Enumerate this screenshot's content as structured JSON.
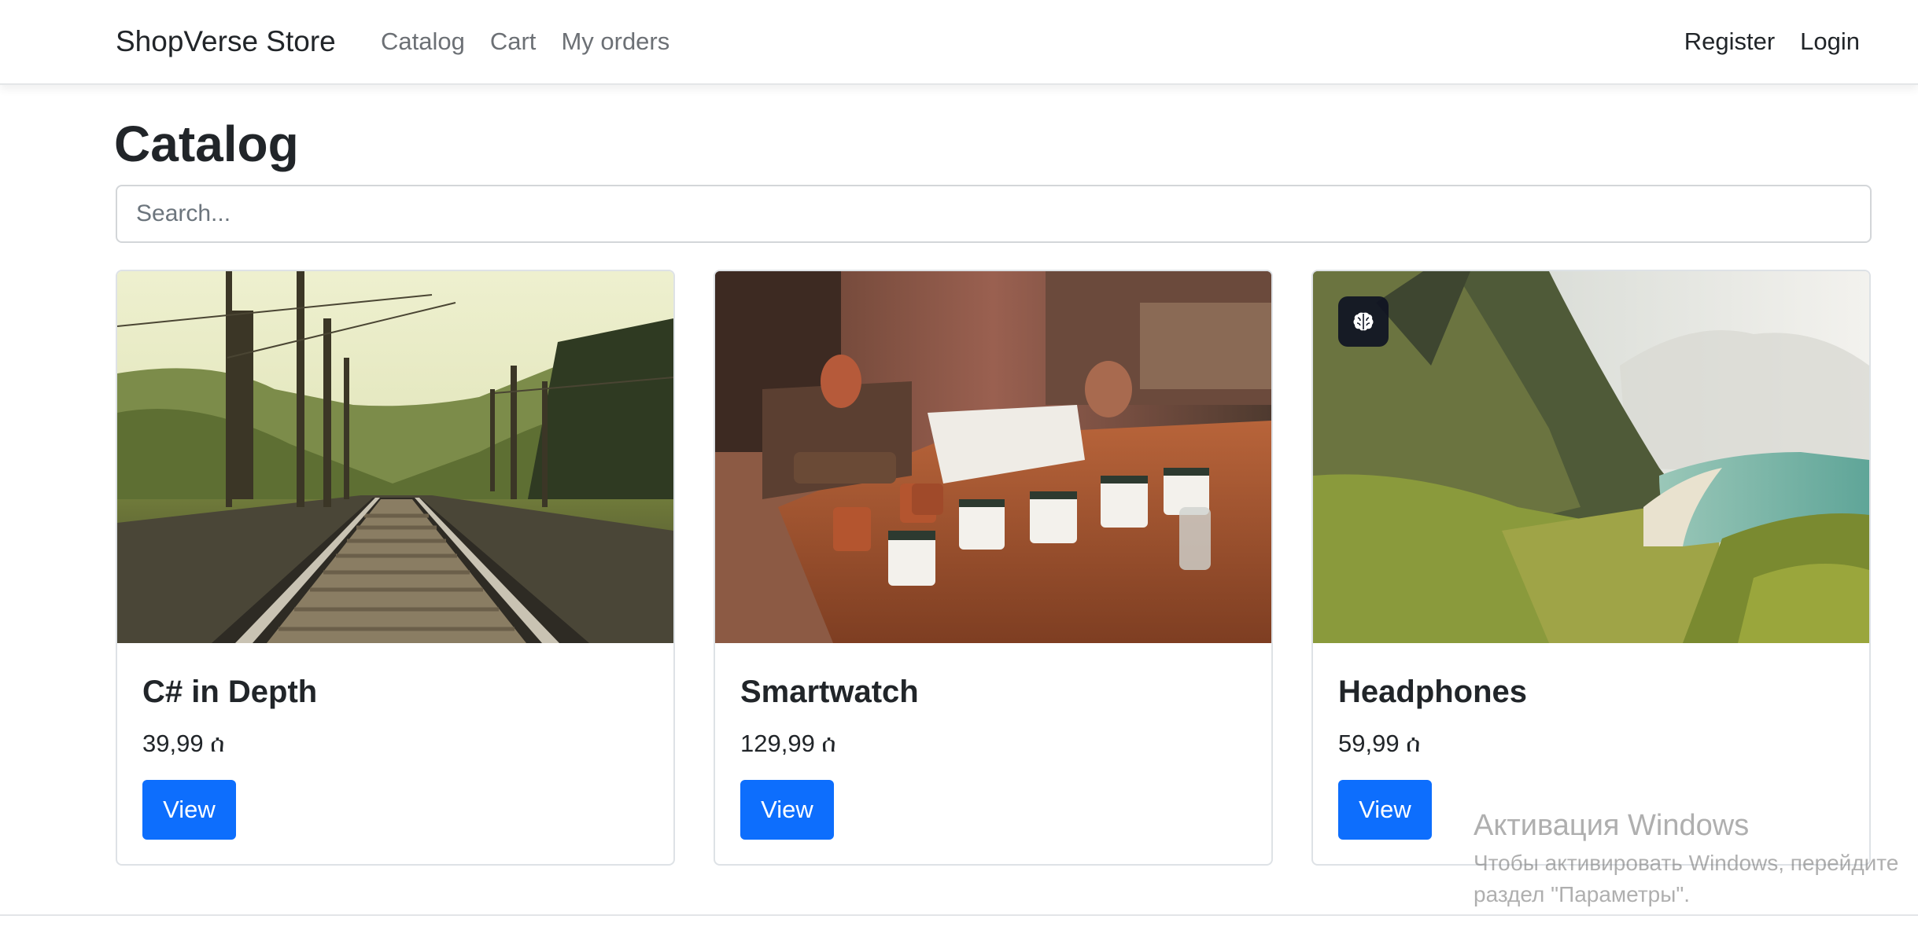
{
  "navbar": {
    "brand": "ShopVerse Store",
    "links": [
      "Catalog",
      "Cart",
      "My orders"
    ],
    "right_links": [
      "Register",
      "Login"
    ]
  },
  "page": {
    "title": "Catalog"
  },
  "search": {
    "placeholder": "Search..."
  },
  "products": [
    {
      "name": "C# in Depth",
      "price": "39,99 ሰ",
      "button": "View",
      "image": "railway-tracks-photo"
    },
    {
      "name": "Smartwatch",
      "price": "129,99 ሰ",
      "button": "View",
      "image": "mugs-on-table-photo"
    },
    {
      "name": "Headphones",
      "price": "59,99 ሰ",
      "button": "View",
      "image": "mountain-beach-photo",
      "badge_icon": "brain-icon"
    }
  ],
  "watermark": {
    "title": "Активация Windows",
    "line1": "Чтобы активировать Windows, перейдите",
    "line2": "раздел \"Параметры\"."
  },
  "colors": {
    "primary": "#0d6efd",
    "text": "#212529",
    "muted_nav": "#6c7075"
  }
}
